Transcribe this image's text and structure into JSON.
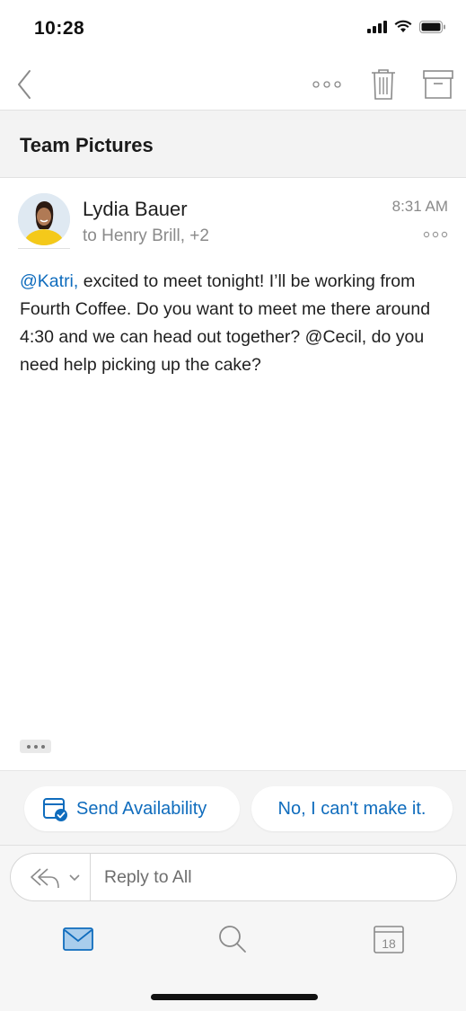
{
  "status_bar": {
    "time": "10:28"
  },
  "toolbar": {
    "back_icon": "chevron-left-icon",
    "more_icon": "more-horizontal-icon",
    "delete_icon": "trash-icon",
    "archive_icon": "archive-icon"
  },
  "thread": {
    "subject": "Team Pictures"
  },
  "message": {
    "sender": "Lydia Bauer",
    "recipients": "to Henry Brill, +2",
    "time": "8:31 AM",
    "body": {
      "mention1": "@Katri,",
      "text": " excited to meet tonight! I’ll be working from Fourth Coffee. Do you want to meet me there around 4:30 and we can head out together? @Cecil, do you need help picking up the cake?"
    }
  },
  "suggested_replies": [
    {
      "label": "Send Availability",
      "icon": "calendar-check-icon"
    },
    {
      "label": "No, I can't make it."
    }
  ],
  "reply": {
    "placeholder": "Reply to All"
  },
  "tabbar": {
    "items": [
      {
        "name": "Mail",
        "icon": "mail-icon"
      },
      {
        "name": "Search",
        "icon": "search-icon"
      },
      {
        "name": "Calendar",
        "icon": "calendar-icon",
        "date": "18"
      }
    ]
  },
  "colors": {
    "accent": "#0f6cbd",
    "muted": "#8a8a8a",
    "background_alt": "#f3f3f3"
  }
}
